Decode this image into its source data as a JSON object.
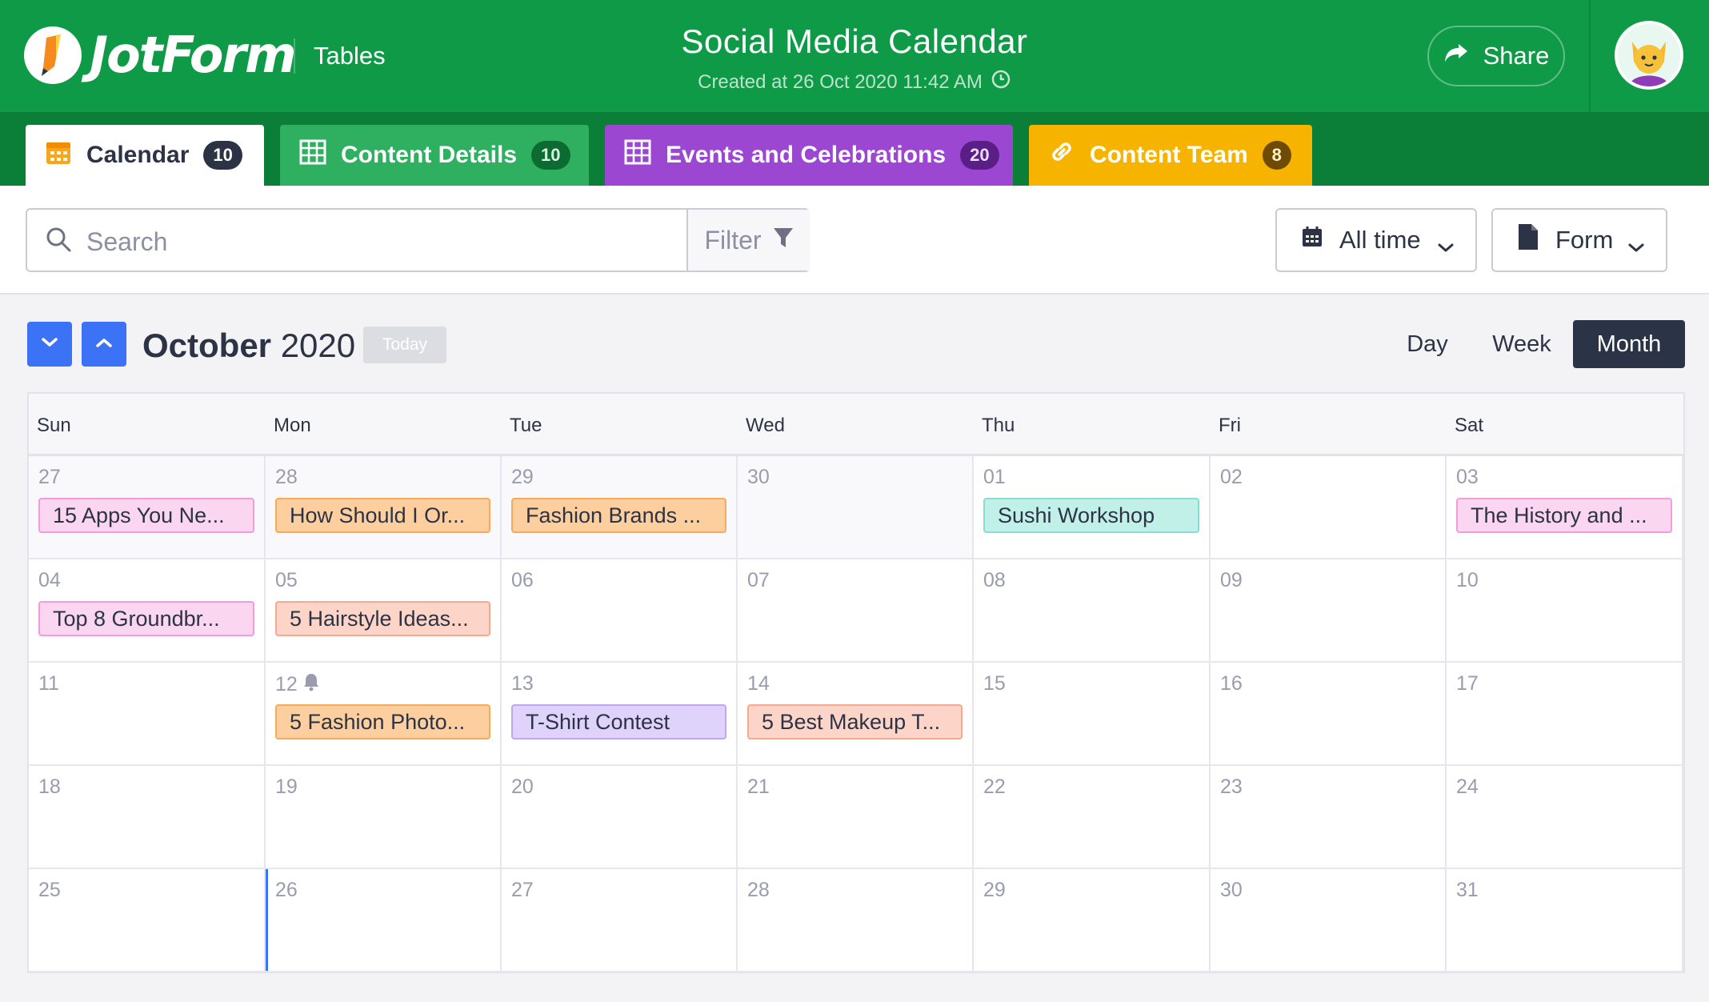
{
  "header": {
    "logo_text": "JotForm",
    "product": "Tables",
    "title": "Social Media Calendar",
    "subtitle": "Created at 26 Oct 2020 11:42 AM",
    "share_label": "Share"
  },
  "tabs": [
    {
      "label": "Calendar",
      "count": "10",
      "icon": "calendar-icon",
      "color": "#ffffff"
    },
    {
      "label": "Content Details",
      "count": "10",
      "icon": "table-grid-icon",
      "color": "#2fb061"
    },
    {
      "label": "Events and Celebrations",
      "count": "20",
      "icon": "table-grid-icon",
      "color": "#9b47d2"
    },
    {
      "label": "Content Team",
      "count": "8",
      "icon": "link-icon",
      "color": "#f6b300"
    }
  ],
  "toolbar": {
    "search_placeholder": "Search",
    "filter_label": "Filter",
    "time_label": "All time",
    "form_label": "Form"
  },
  "calendar": {
    "month": "October",
    "year": "2020",
    "today_label": "Today",
    "views": [
      "Day",
      "Week",
      "Month"
    ],
    "active_view": "Month",
    "weekdays": [
      "Sun",
      "Mon",
      "Tue",
      "Wed",
      "Thu",
      "Fri",
      "Sat"
    ],
    "weeks": [
      [
        {
          "day": "27",
          "out": true,
          "event": "15 Apps You Ne...",
          "color": "pink"
        },
        {
          "day": "28",
          "out": true,
          "event": "How Should I Or...",
          "color": "orange"
        },
        {
          "day": "29",
          "out": true,
          "event": "Fashion Brands ...",
          "color": "orange"
        },
        {
          "day": "30",
          "out": true
        },
        {
          "day": "01",
          "event": "Sushi Workshop",
          "color": "teal"
        },
        {
          "day": "02"
        },
        {
          "day": "03",
          "event": "The History and ...",
          "color": "pink"
        }
      ],
      [
        {
          "day": "04",
          "event": "Top 8 Groundbr...",
          "color": "pink"
        },
        {
          "day": "05",
          "event": "5 Hairstyle Ideas...",
          "color": "salmon"
        },
        {
          "day": "06"
        },
        {
          "day": "07"
        },
        {
          "day": "08"
        },
        {
          "day": "09"
        },
        {
          "day": "10"
        }
      ],
      [
        {
          "day": "11"
        },
        {
          "day": "12",
          "bell": true,
          "event": "5 Fashion Photo...",
          "color": "orange"
        },
        {
          "day": "13",
          "event": "T-Shirt Contest",
          "color": "purple"
        },
        {
          "day": "14",
          "event": "5 Best Makeup T...",
          "color": "salmon"
        },
        {
          "day": "15"
        },
        {
          "day": "16"
        },
        {
          "day": "17"
        }
      ],
      [
        {
          "day": "18"
        },
        {
          "day": "19"
        },
        {
          "day": "20"
        },
        {
          "day": "21"
        },
        {
          "day": "22"
        },
        {
          "day": "23"
        },
        {
          "day": "24"
        }
      ],
      [
        {
          "day": "25"
        },
        {
          "day": "26",
          "today": true
        },
        {
          "day": "27"
        },
        {
          "day": "28"
        },
        {
          "day": "29"
        },
        {
          "day": "30"
        },
        {
          "day": "31"
        }
      ]
    ]
  },
  "colors": {
    "header_green": "#0f9a47",
    "tab_bar_green": "#0b7f37",
    "nav_blue": "#3c73f6",
    "active_view_dark": "#2b3447"
  }
}
